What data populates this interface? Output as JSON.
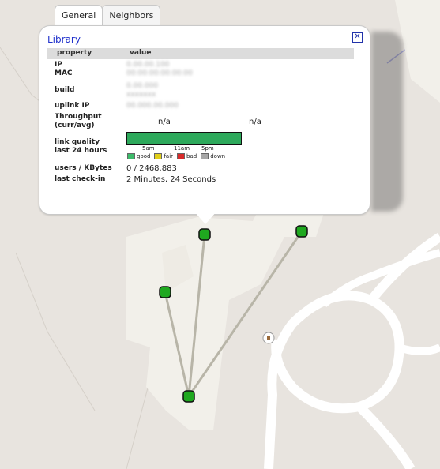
{
  "colors": {
    "node": "#1fa81f",
    "link": "#b8b5a8",
    "road": "#ffffff",
    "building": "#f2f0ea",
    "quality_good": "#2da95b",
    "legend_good": "#3dbb6a",
    "legend_fair": "#e1cf1a",
    "legend_bad": "#d82b2b",
    "legend_down": "#a6a6a6"
  },
  "tabs": [
    "General",
    "Neighbors"
  ],
  "popup": {
    "title": "Library",
    "close_icon": "close-icon",
    "header": {
      "property": "property",
      "value": "value"
    },
    "ip_label": "IP",
    "mac_label": "MAC",
    "ip_value": "0.00.00.100",
    "mac_value": "00:00:00:00:00:00",
    "build_label": "build",
    "build_value_1": "0.00.000",
    "build_value_2": "xxxxxxx",
    "uplink_label": "uplink IP",
    "uplink_value": "00.000.00.000",
    "throughput_label_1": "Throughput",
    "throughput_label_2": "(curr/avg)",
    "throughput_curr": "n/a",
    "throughput_avg": "n/a",
    "quality_label_1": "link quality",
    "quality_label_2": "last 24 hours",
    "quality_good_fraction": 1.0,
    "ticks": [
      "5am",
      "11am",
      "5pm"
    ],
    "legend": [
      "good",
      "fair",
      "bad",
      "down"
    ],
    "users_label": "users / KBytes",
    "users_value": "0 / 2468.883",
    "checkin_label": "last check-in",
    "checkin_value": "2 Minutes, 24 Seconds"
  }
}
